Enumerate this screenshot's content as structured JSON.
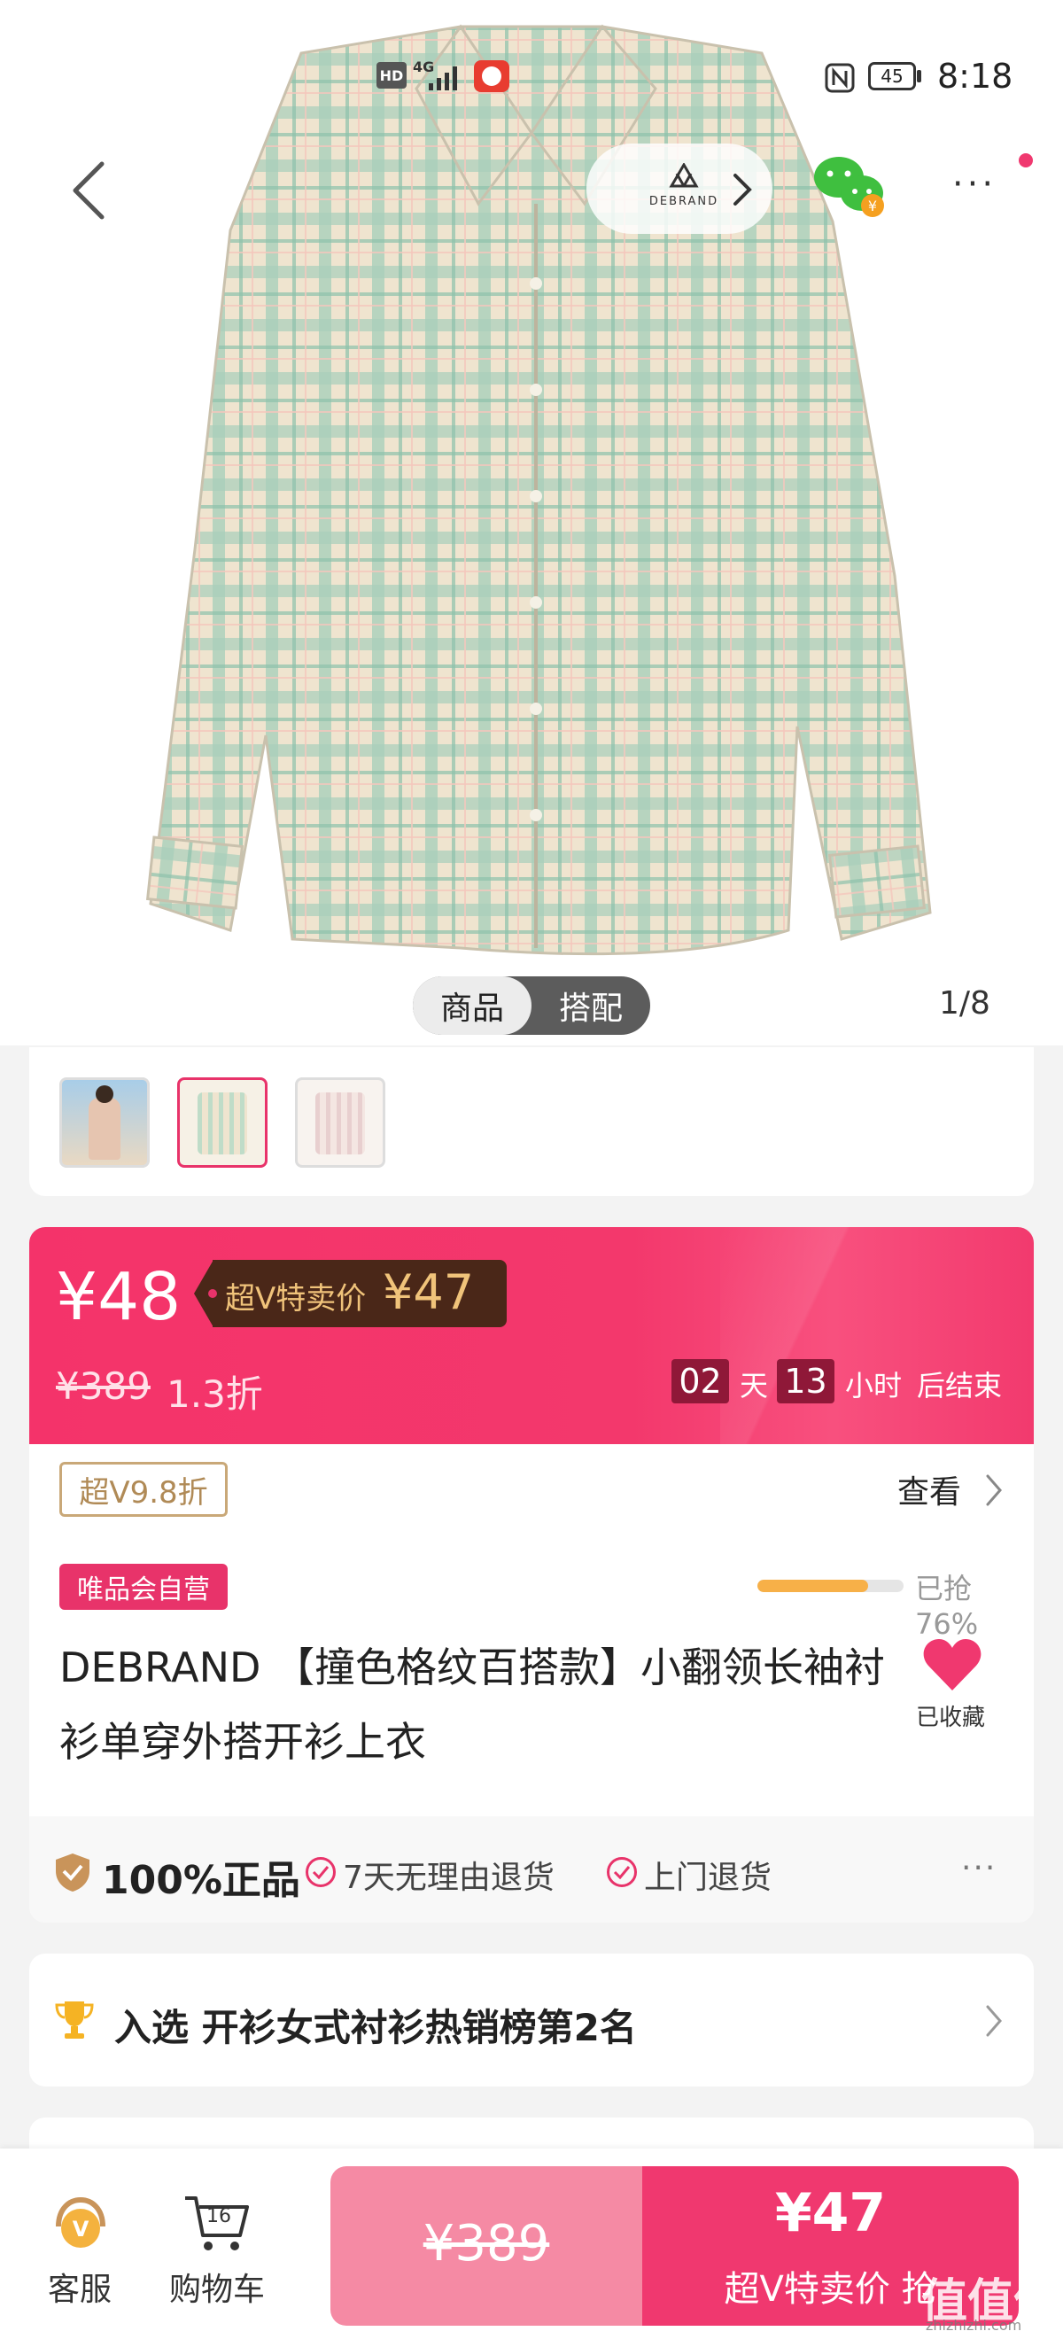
{
  "status_bar": {
    "left_icons": [
      "HD",
      "4G"
    ],
    "battery": "45",
    "time": "8:18"
  },
  "top_nav": {
    "brand_logo_text": "DEBRAND",
    "more": "···"
  },
  "gallery": {
    "tabs": [
      "商品",
      "搭配"
    ],
    "active_tab": 1,
    "counter": "1/8",
    "thumbnail_count": 3,
    "selected_thumbnail": 1
  },
  "price": {
    "current": "¥48",
    "vip_label": "超V特卖价",
    "vip_price": "¥47",
    "original": "¥389",
    "discount": "1.3折",
    "countdown": {
      "days": "02",
      "days_unit": "天",
      "hours": "13",
      "hours_unit": "小时",
      "suffix": "后结束"
    }
  },
  "vip_discount": {
    "badge": "超V9.8折",
    "view": "查看"
  },
  "product": {
    "self_operated": "唯品会自营",
    "sold_label": "已抢76%",
    "sold_progress": 0.76,
    "title": "DEBRAND 【撞色格纹百搭款】小翻领长袖衬衫单穿外搭开衫上衣",
    "favorite_label": "已收藏"
  },
  "guarantee": {
    "genuine": "100%正品",
    "return7": "7天无理由退货",
    "pickup": "上门退货",
    "more": "···"
  },
  "ranking": {
    "text": "入选 开衫女式衬衫热销榜第2名"
  },
  "bottom_bar": {
    "service": "客服",
    "cart": "购物车",
    "cart_count": "16",
    "orig_price": "¥389",
    "buy_price": "¥47",
    "buy_label": "超V特卖价 抢"
  },
  "watermark": {
    "text": "值值值",
    "sub": "zhizhizhi.com"
  },
  "colors": {
    "accent": "#e8336a",
    "gold": "#f0c37a",
    "vip_tag_bg": "#4a2718"
  }
}
